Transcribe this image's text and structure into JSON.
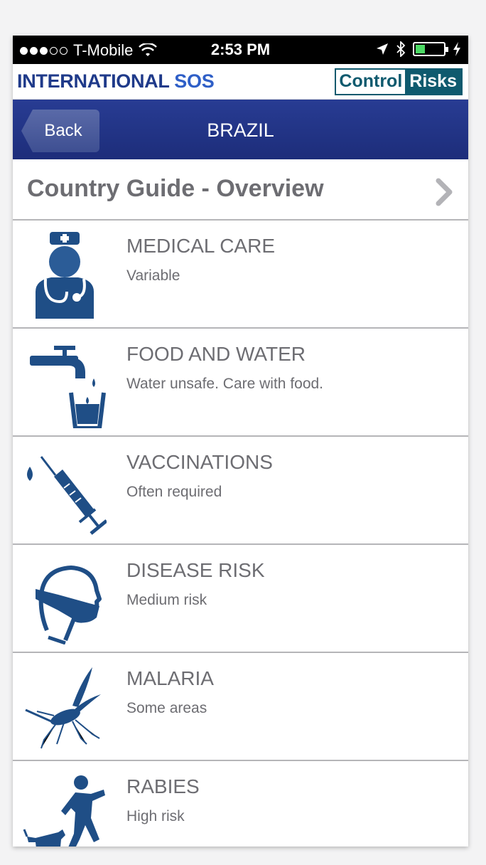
{
  "status_bar": {
    "carrier": "T-Mobile",
    "time": "2:53 PM",
    "signal_dots_full": 3,
    "signal_dots_total": 5,
    "battery_level": 0.3
  },
  "brand": {
    "left_main": "INTERNATIONAL",
    "left_accent": "SOS",
    "right_part1": "Control",
    "right_part2": "Risks"
  },
  "navbar": {
    "back_label": "Back",
    "title": "BRAZIL"
  },
  "overview": {
    "title": "Country Guide - Overview"
  },
  "items": [
    {
      "label": "MEDICAL CARE",
      "value": "Variable",
      "icon": "doctor-icon"
    },
    {
      "label": "FOOD AND WATER",
      "value": "Water unsafe. Care with food.",
      "icon": "tap-water-icon"
    },
    {
      "label": "VACCINATIONS",
      "value": "Often required",
      "icon": "syringe-icon"
    },
    {
      "label": "DISEASE RISK",
      "value": "Medium risk",
      "icon": "face-mask-icon"
    },
    {
      "label": "MALARIA",
      "value": "Some areas",
      "icon": "mosquito-icon"
    },
    {
      "label": "RABIES",
      "value": "High risk",
      "icon": "dog-chasing-icon"
    }
  ],
  "colors": {
    "icon_blue": "#1f4e86",
    "nav_blue": "#223585",
    "text_gray": "#6d6d72"
  }
}
